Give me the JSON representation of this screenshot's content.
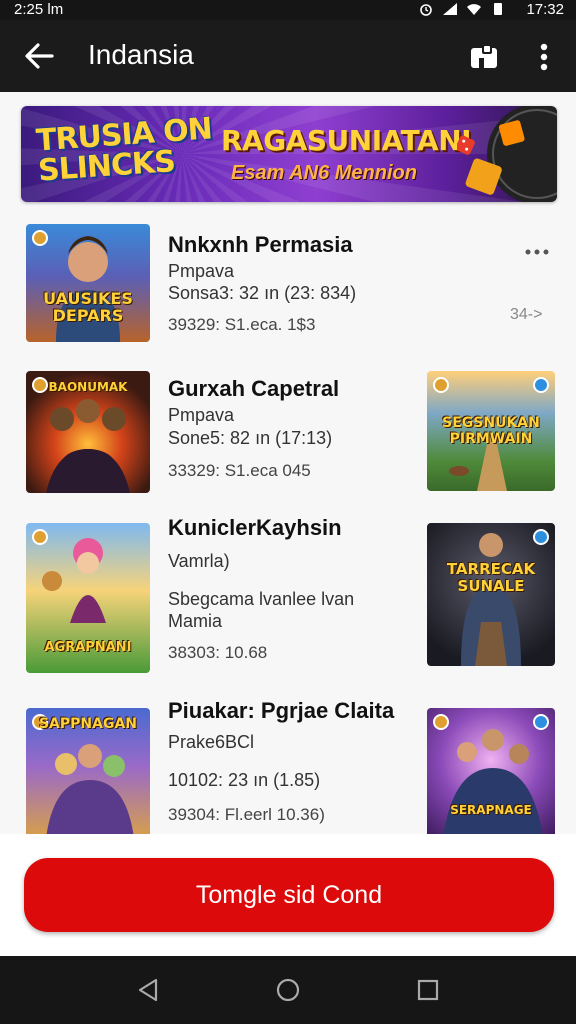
{
  "status_bar": {
    "time": "2:25 lm",
    "time_right": "17:32"
  },
  "app_bar": {
    "title": "Indansia"
  },
  "banner": {
    "logo_text": "TRUSIA ON SLINCKS",
    "headline": "RAGASUNIATANI",
    "subline": "Esam AN6 Mennion"
  },
  "items": [
    {
      "title": "Nnkxnh Permasia",
      "line1": "Pmpava",
      "line2": "Sonsa3: 32 ın (23: 834)",
      "line3": "39329: S1.eca. 1$3",
      "thumb_label": "UAUSIKES DEPARS",
      "meta_right": "34->"
    },
    {
      "title": "Gurxah Capetral",
      "line1": "Pmpava",
      "line2": "Sone5: 82 ın (17:13)",
      "line3": "33329: S1.eca 045",
      "thumb_label": "BAONUMAK",
      "thumb_right_label": "SEGSNUKAN PIRMWAIN"
    },
    {
      "title": "KuniclerKayhsin",
      "line1": "Vamrla)",
      "line2": "Sbegcama lvanlee lvan",
      "line2b": "Mamia",
      "line3": "38303: 10.68",
      "thumb_label": "AGRAPNANI",
      "thumb_right_label": "TARRECAK SUNALE"
    },
    {
      "title": "Piuakar: Pgrjae Claita",
      "line1": "Prake6BCl",
      "line2": "10102: 23 ın (1.85)",
      "line3": "39304: Fl.eerl 10.36)",
      "thumb_label": "SAPPNAGAN",
      "thumb_right_label": "SERAPNAGE"
    }
  ],
  "cta": {
    "label": "Tomgle sid Cond"
  },
  "colors": {
    "accent": "#dc0a0a",
    "appbar": "#1b1b1b"
  }
}
